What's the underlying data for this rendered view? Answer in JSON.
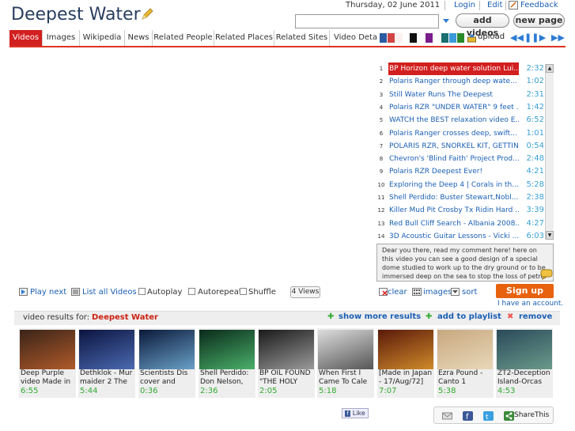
{
  "header": {
    "title": "Deepest Water",
    "date": "Thursday, 02 June 2011",
    "login": "Login",
    "edit": "Edit",
    "feedback": "Feedback",
    "search_value": "",
    "add_videos": "add videos",
    "new_page": "new page"
  },
  "tabs": [
    {
      "label": "Videos",
      "active": true
    },
    {
      "label": "Images"
    },
    {
      "label": "Wikipedia"
    },
    {
      "label": "News"
    },
    {
      "label": "Related People"
    },
    {
      "label": "Related Places"
    },
    {
      "label": "Related Sites"
    },
    {
      "label": "Video Deta"
    }
  ],
  "swatches": [
    "#2c5aa0",
    "#d14545",
    "#fff0f0",
    "#111111",
    "#7a1c8c",
    "#1b6e6e",
    "#3a9ad9",
    "#2a8a2a"
  ],
  "upload": "upload",
  "playlist": [
    {
      "n": "1",
      "title": "BP Horizon deep water solution Lui...",
      "dur": "2:32",
      "selected": true
    },
    {
      "n": "2",
      "title": "Polaris Ranger through deep wate...",
      "dur": "1:02"
    },
    {
      "n": "3",
      "title": "Still Water Runs The Deepest",
      "dur": "2:31"
    },
    {
      "n": "4",
      "title": "Polaris RZR \"UNDER WATER\" 9 feet ...",
      "dur": "1:42"
    },
    {
      "n": "5",
      "title": "WATCH the BEST relaxation video E...",
      "dur": "6:52"
    },
    {
      "n": "6",
      "title": "Polaris Ranger crosses deep, swift...",
      "dur": "1:01"
    },
    {
      "n": "7",
      "title": "POLARIS RZR, SNORKEL KIT, GETTIN...",
      "dur": "0:54"
    },
    {
      "n": "8",
      "title": "Chevron's 'Blind Faith' Project Prod...",
      "dur": "2:48"
    },
    {
      "n": "9",
      "title": "Polaris RZR Deepest Ever!",
      "dur": "4:21"
    },
    {
      "n": "10",
      "title": "Exploring the Deep 4 | Corals in th...",
      "dur": "5:28"
    },
    {
      "n": "11",
      "title": "Shell Perdido: Buster Stewart,Nobl...",
      "dur": "2:38"
    },
    {
      "n": "12",
      "title": "Killer Mud Pit Crosby Tx Ridin Hard ...",
      "dur": "3:39"
    },
    {
      "n": "13",
      "title": "Red Bull Cliff Search - Albania 2008...",
      "dur": "4:27"
    },
    {
      "n": "14",
      "title": "3D Acoustic Guitar Lessons - Vicki ...",
      "dur": "6:03"
    }
  ],
  "comment": "Dear you there, read my comment here! here on this video you can see a good design of a special dome studied to work up to the dry ground or to be immersed deep on the sea to stop the loss of petrol from the well on the bottom of the sea so",
  "controls": {
    "play_next": "Play next",
    "list_all": "List all Videos",
    "autoplay": "Autoplay",
    "autorepeat": "Autorepeat",
    "shuffle": "Shuffle",
    "views": "4 Views",
    "clear": "clear",
    "images": "images",
    "sort": "sort",
    "signup": "Sign up",
    "account": "I have an account."
  },
  "results": {
    "label": "video results for:",
    "query": "Deepest Water",
    "show_more": "show more results",
    "add_playlist": "add to playlist",
    "remove": "remove"
  },
  "thumbs": [
    {
      "title": "Deep Purple video Made in",
      "dur": "6:55",
      "c1": "#3a2418",
      "c2": "#b05a2a"
    },
    {
      "title": "Dethklok - Mur maider 2 The",
      "dur": "5:44",
      "c1": "#0c1440",
      "c2": "#4a6ab0"
    },
    {
      "title": "Scientists Dis cover and",
      "dur": "0:36",
      "c1": "#0a1a3a",
      "c2": "#6aa0c8"
    },
    {
      "title": "Shell Perdido: Don Nelson,",
      "dur": "2:36",
      "c1": "#0a2a1a",
      "c2": "#4ab06a"
    },
    {
      "title": "BP OIL FOUND \"THE HOLY",
      "dur": "2:05",
      "c1": "#1a1a1a",
      "c2": "#9a9a9a"
    },
    {
      "title": "When First I Came To Cale",
      "dur": "5:18",
      "c1": "#ddd",
      "c2": "#555"
    },
    {
      "title": "[Made in Japan - 17/Aug/72]",
      "dur": "7:07",
      "c1": "#5a1a0a",
      "c2": "#d08a2a"
    },
    {
      "title": "Ezra Pound - Canto 1",
      "dur": "5:38",
      "c1": "#c8a880",
      "c2": "#e8d8b8"
    },
    {
      "title": "ZT2-Deception Island-Orcas",
      "dur": "4:53",
      "c1": "#2a4a5a",
      "c2": "#6a9a8a"
    }
  ],
  "bottom": {
    "like": "Like",
    "sharethis": "ShareThis"
  }
}
